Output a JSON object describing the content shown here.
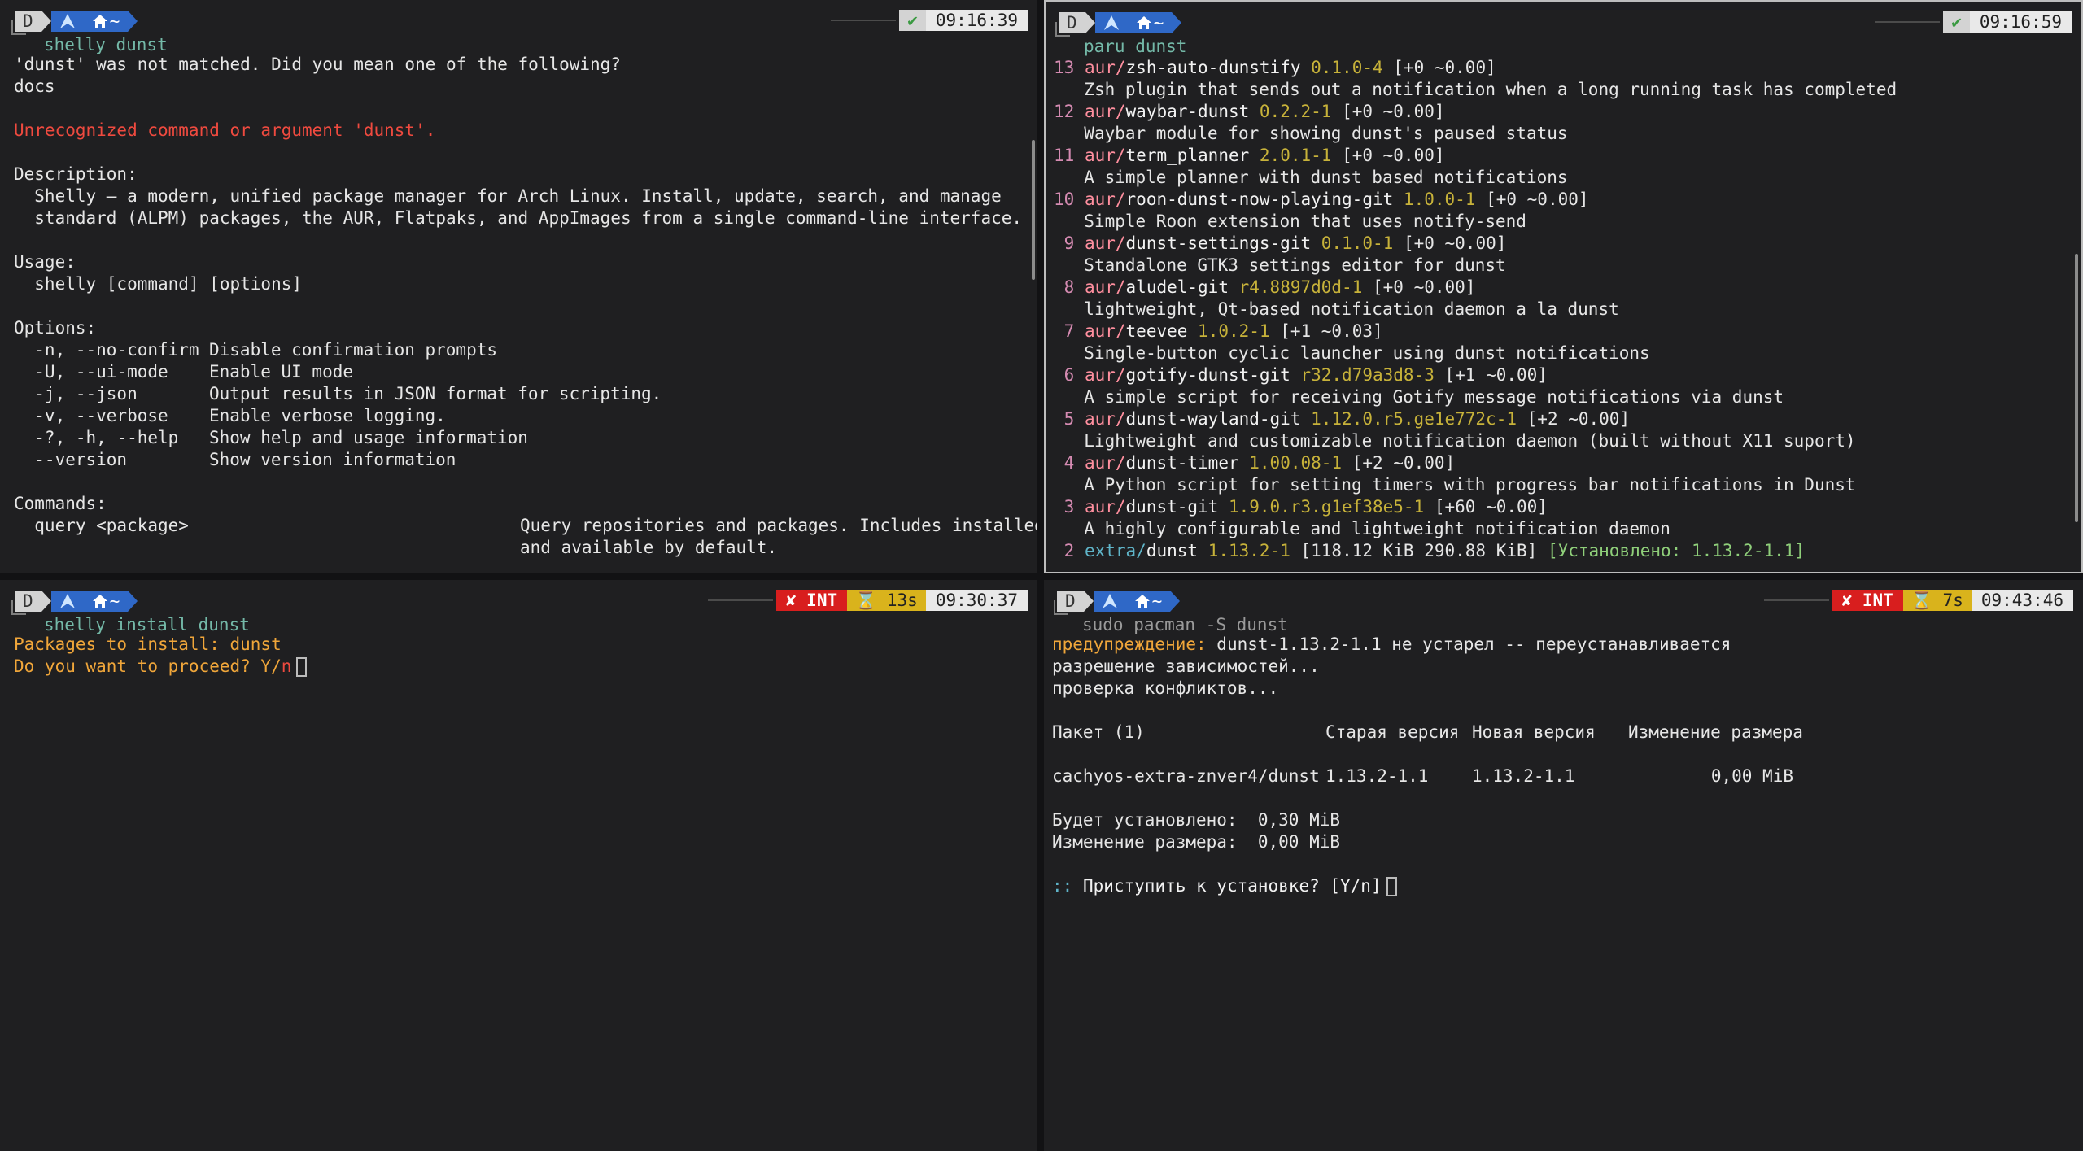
{
  "colors": {
    "pane_bg": "#1f1f21",
    "accent_blue": "#2f68c7",
    "error": "#ef4a3f",
    "warning": "#f0a63a",
    "version": "#c7b23a"
  },
  "prompt": {
    "d_label": "D",
    "arch_icon": "arch-logo-icon",
    "home_label": "~",
    "home_icon": "home-icon"
  },
  "top_left": {
    "status_ok": "✔",
    "time": "09:16:39",
    "command": "shelly dunst",
    "output": {
      "l1": "'dunst' was not matched. Did you mean one of the following?",
      "l2": "docs",
      "err": "Unrecognized command or argument 'dunst'.",
      "desc_h": "Description:",
      "desc1": "  Shelly — a modern, unified package manager for Arch Linux. Install, update, search, and manage",
      "desc2": "  standard (ALPM) packages, the AUR, Flatpaks, and AppImages from a single command-line interface.",
      "usage_h": "Usage:",
      "usage1": "  shelly [command] [options]",
      "opt_h": "Options:",
      "opts": [
        {
          "flag": "  -n, --no-confirm",
          "desc": "Disable confirmation prompts"
        },
        {
          "flag": "  -U, --ui-mode",
          "desc": "Enable UI mode"
        },
        {
          "flag": "  -j, --json",
          "desc": "Output results in JSON format for scripting."
        },
        {
          "flag": "  -v, --verbose",
          "desc": "Enable verbose logging."
        },
        {
          "flag": "  -?, -h, --help",
          "desc": "Show help and usage information"
        },
        {
          "flag": "  --version",
          "desc": "Show version information"
        }
      ],
      "cmd_h": "Commands:",
      "cmd1_name": "  query <package>",
      "cmd1_desc1": "Query repositories and packages. Includes installed",
      "cmd1_desc2": "and available by default."
    }
  },
  "top_right": {
    "status_ok": "✔",
    "time": "09:16:59",
    "command": "paru dunst",
    "results": [
      {
        "num": "13",
        "repo": "aur/",
        "name": "zsh-auto-dunstify",
        "ver": "0.1.0-4",
        "meta": "[+0 ~0.00]",
        "desc": "Zsh plugin that sends out a notification when a long running task has completed"
      },
      {
        "num": "12",
        "repo": "aur/",
        "name": "waybar-dunst",
        "ver": "0.2.2-1",
        "meta": "[+0 ~0.00]",
        "desc": "Waybar module for showing dunst's paused status"
      },
      {
        "num": "11",
        "repo": "aur/",
        "name": "term_planner",
        "ver": "2.0.1-1",
        "meta": "[+0 ~0.00]",
        "desc": "A simple planner with dunst based notifications"
      },
      {
        "num": "10",
        "repo": "aur/",
        "name": "roon-dunst-now-playing-git",
        "ver": "1.0.0-1",
        "meta": "[+0 ~0.00]",
        "desc": "Simple Roon extension that uses notify-send"
      },
      {
        "num": " 9",
        "repo": "aur/",
        "name": "dunst-settings-git",
        "ver": "0.1.0-1",
        "meta": "[+0 ~0.00]",
        "desc": "Standalone GTK3 settings editor for dunst"
      },
      {
        "num": " 8",
        "repo": "aur/",
        "name": "aludel-git",
        "ver": "r4.8897d0d-1",
        "meta": "[+0 ~0.00]",
        "desc": "lightweight, Qt-based notification daemon a la dunst"
      },
      {
        "num": " 7",
        "repo": "aur/",
        "name": "teevee",
        "ver": "1.0.2-1",
        "meta": "[+1 ~0.03]",
        "desc": "Single-button cyclic launcher using dunst notifications"
      },
      {
        "num": " 6",
        "repo": "aur/",
        "name": "gotify-dunst-git",
        "ver": "r32.d79a3d8-3",
        "meta": "[+1 ~0.00]",
        "desc": "A simple script for receiving Gotify message notifications via dunst"
      },
      {
        "num": " 5",
        "repo": "aur/",
        "name": "dunst-wayland-git",
        "ver": "1.12.0.r5.ge1e772c-1",
        "meta": "[+2 ~0.00]",
        "desc": "Lightweight and customizable notification daemon (built without X11 suport)"
      },
      {
        "num": " 4",
        "repo": "aur/",
        "name": "dunst-timer",
        "ver": "1.00.08-1",
        "meta": "[+2 ~0.00]",
        "desc": "A Python script for setting timers with progress bar notifications in Dunst"
      },
      {
        "num": " 3",
        "repo": "aur/",
        "name": "dunst-git",
        "ver": "1.9.0.r3.g1ef38e5-1",
        "meta": "[+60 ~0.00]",
        "desc": "A highly configurable and lightweight notification daemon"
      }
    ],
    "last": {
      "num": " 2",
      "repo": "extra/",
      "name": "dunst",
      "ver": "1.13.2-1",
      "meta": "[118.12 KiB 290.88 KiB]",
      "installed": "[Установлено: 1.13.2-1.1]"
    }
  },
  "bottom_left": {
    "int_label": "✘ INT",
    "duration": "⌛ 13s",
    "time": "09:30:37",
    "command": "shelly install dunst",
    "l1": "Packages to install: dunst",
    "l2_a": "Do you want to proceed? Y/",
    "l2_b": "n"
  },
  "bottom_right": {
    "int_label": "✘ INT",
    "duration": "⌛ 7s",
    "time": "09:43:46",
    "command": "sudo pacman -S dunst",
    "warn_label": "предупреждение:",
    "warn_text": " dunst-1.13.2-1.1 не устарел -- переустанавливается",
    "l2": "разрешение зависимостей...",
    "l3": "проверка конфликтов...",
    "table": {
      "h_pkg": "Пакет (1)",
      "h_old": "Старая версия",
      "h_new": "Новая версия",
      "h_size": "Изменение размера",
      "row_pkg": "cachyos-extra-znver4/dunst",
      "row_old": "1.13.2-1.1",
      "row_new": "1.13.2-1.1",
      "row_size": "0,00 MiB"
    },
    "install_size": "Будет установлено:  0,30 MiB",
    "change_size": "Изменение размера:  0,00 MiB",
    "prompt_prefix": "::",
    "prompt_text": " Приступить к установке? [Y/n]"
  }
}
